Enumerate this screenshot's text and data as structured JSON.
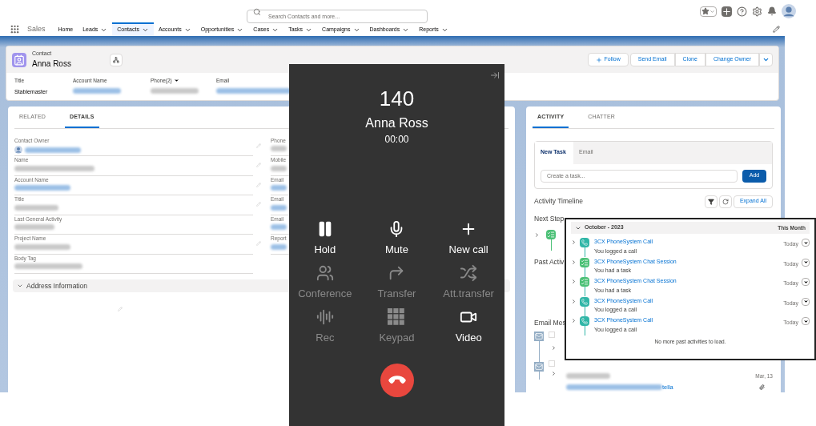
{
  "app": {
    "name": "Sales",
    "search_placeholder": "Search Contacts and more..."
  },
  "nav": [
    {
      "label": "Home",
      "menu": false,
      "selected": false
    },
    {
      "label": "Leads",
      "menu": true,
      "selected": false
    },
    {
      "label": "Contacts",
      "menu": true,
      "selected": true
    },
    {
      "label": "Accounts",
      "menu": true,
      "selected": false
    },
    {
      "label": "Opportunities",
      "menu": true,
      "selected": false
    },
    {
      "label": "Cases",
      "menu": true,
      "selected": false
    },
    {
      "label": "Tasks",
      "menu": true,
      "selected": false
    },
    {
      "label": "Campaigns",
      "menu": true,
      "selected": false
    },
    {
      "label": "Dashboards",
      "menu": true,
      "selected": false
    },
    {
      "label": "Reports",
      "menu": true,
      "selected": false
    }
  ],
  "record": {
    "type": "Contact",
    "name": "Anna Ross",
    "actions": [
      {
        "label": "Follow",
        "kind": "follow"
      },
      {
        "label": "Send Email",
        "kind": "plain"
      },
      {
        "label": "Clone",
        "kind": "plain"
      },
      {
        "label": "Change Owner",
        "kind": "plain"
      }
    ],
    "highlights": [
      {
        "label": "Title",
        "value": "Stablemaster",
        "menu": false
      },
      {
        "label": "Account Name",
        "link": true,
        "menu": false
      },
      {
        "label": "Phone(2)",
        "link": false,
        "menu": true
      },
      {
        "label": "Email",
        "link": true,
        "menu": false
      }
    ]
  },
  "details": {
    "tabs": [
      {
        "label": "RELATED",
        "selected": false
      },
      {
        "label": "DETAILS",
        "selected": true
      }
    ],
    "fields": [
      {
        "label": "Contact Owner",
        "link": true
      },
      {
        "label": "Name",
        "link": false
      },
      {
        "label": "Account Name",
        "link": true
      },
      {
        "label": "Title",
        "link": false
      },
      {
        "label": "Last General Activity",
        "link": false
      },
      {
        "label": "Project Name",
        "link": false
      },
      {
        "label": "Body Tag",
        "link": false
      }
    ],
    "fields_right": [
      {
        "label": "Phone",
        "link": false
      },
      {
        "label": "Mobile",
        "link": false
      },
      {
        "label": "Email",
        "link": true
      },
      {
        "label": "Email",
        "link": true
      },
      {
        "label": "Email",
        "link": true
      },
      {
        "label": "Report",
        "link": true
      }
    ],
    "section": {
      "label": "Address Information",
      "expanded": true
    }
  },
  "activity": {
    "tabs": [
      {
        "label": "ACTIVITY",
        "selected": true
      },
      {
        "label": "CHATTER",
        "selected": false
      }
    ],
    "composer_tabs": [
      {
        "label": "New Task",
        "selected": true
      },
      {
        "label": "Email",
        "selected": false
      }
    ],
    "task_placeholder": "Create a task...",
    "add_label": "Add",
    "timeline_title": "Activity Timeline",
    "expand_label": "Expand All",
    "next_steps": "Next Step",
    "past": "Past Activ",
    "email_messages": "Email Mes",
    "email_checkboxes": [
      {
        "checked": false
      },
      {
        "checked": false
      }
    ],
    "email_date": "Mar, 13",
    "email_link_tail": "tella"
  },
  "call": {
    "number": "140",
    "name": "Anna Ross",
    "duration": "00:00",
    "controls": [
      {
        "kind": "hold",
        "label": "Hold",
        "enabled": true
      },
      {
        "kind": "mute",
        "label": "Mute",
        "enabled": true
      },
      {
        "kind": "new_call",
        "label": "New call",
        "enabled": true
      },
      {
        "kind": "conference",
        "label": "Conference",
        "enabled": false
      },
      {
        "kind": "transfer",
        "label": "Transfer",
        "enabled": false
      },
      {
        "kind": "att_transfer",
        "label": "Att.transfer",
        "enabled": false
      },
      {
        "kind": "rec",
        "label": "Rec",
        "enabled": false
      },
      {
        "kind": "keypad",
        "label": "Keypad",
        "enabled": false
      },
      {
        "kind": "video",
        "label": "Video",
        "enabled": true
      }
    ]
  },
  "timeline": {
    "month": "October - 2023",
    "period": "This Month",
    "expanded": true,
    "items": [
      {
        "kind": "call",
        "title": "3CX PhoneSystem Call",
        "subtitle": "You logged a call",
        "when": "Today"
      },
      {
        "kind": "task",
        "title": "3CX PhoneSystem Chat Session",
        "subtitle": "You had a task",
        "when": "Today"
      },
      {
        "kind": "task",
        "title": "3CX PhoneSystem Chat Session",
        "subtitle": "You had a task",
        "when": "Today"
      },
      {
        "kind": "call",
        "title": "3CX PhoneSystem Call",
        "subtitle": "You logged a call",
        "when": "Today"
      },
      {
        "kind": "call",
        "title": "3CX PhoneSystem Call",
        "subtitle": "You logged a call",
        "when": "Today"
      }
    ],
    "footer": "No more past activities to load."
  }
}
